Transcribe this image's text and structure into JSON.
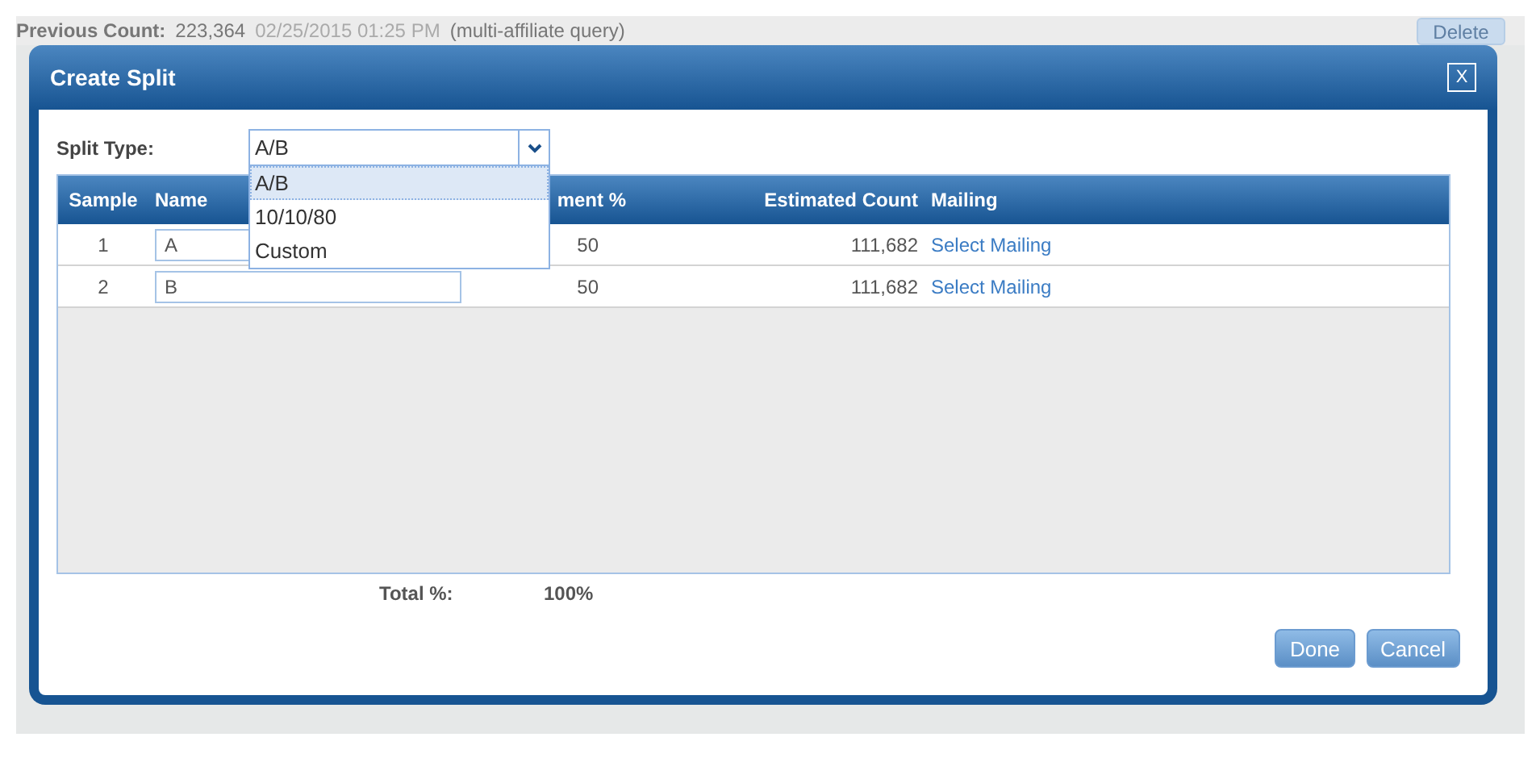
{
  "background": {
    "previous_count_label": "Previous Count:",
    "previous_count": "223,364",
    "timestamp": "02/25/2015 01:25 PM",
    "note": "(multi-affiliate query)",
    "delete_button": {
      "label": "Delete",
      "disabled": true
    }
  },
  "dialog": {
    "title": "Create Split",
    "close": "X",
    "split_type": {
      "label": "Split Type:",
      "value": "A/B",
      "expanded": true,
      "options": [
        {
          "label": "A/B",
          "selected": true
        },
        {
          "label": "10/10/80",
          "selected": false
        },
        {
          "label": "Custom",
          "selected": false
        }
      ]
    },
    "table": {
      "columns": [
        "Sample",
        "Name",
        "ment %",
        "Estimated Count",
        "Mailing"
      ],
      "rows": [
        {
          "sample": "1",
          "name": "A",
          "percent": "50",
          "count": "111,682",
          "mailing": "Select Mailing"
        },
        {
          "sample": "2",
          "name": "B",
          "percent": "50",
          "count": "111,682",
          "mailing": "Select Mailing"
        }
      ]
    },
    "total_label": "Total %:",
    "total": "100%",
    "buttons": [
      "Done",
      "Cancel"
    ]
  }
}
